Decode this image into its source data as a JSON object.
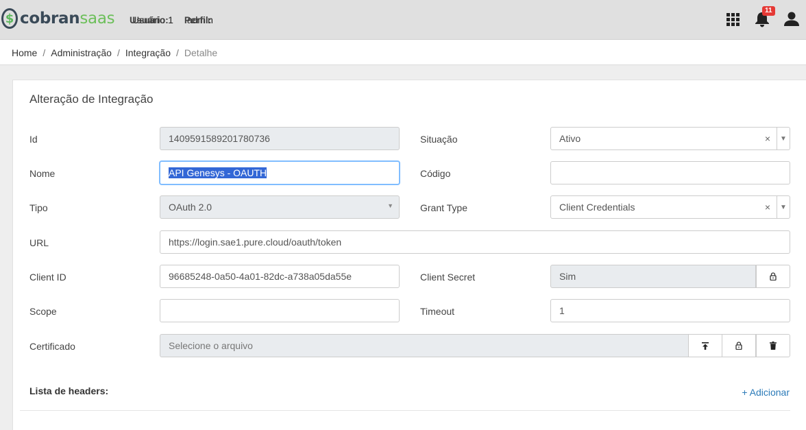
{
  "app": {
    "logo_mark": "$",
    "logo_part1": "cobran",
    "logo_part2": "saas",
    "user_label": "Usuário:",
    "user_value": "Usuário 1",
    "profile_label": "Perfil:",
    "profile_value": "admin",
    "notification_count": "11"
  },
  "breadcrumb": {
    "items": [
      "Home",
      "Administração",
      "Integração"
    ],
    "active": "Detalhe",
    "separator": "/"
  },
  "form": {
    "title": "Alteração de Integração",
    "id": {
      "label": "Id",
      "value": "1409591589201780736"
    },
    "situacao": {
      "label": "Situação",
      "value": "Ativo",
      "clear": "×"
    },
    "nome": {
      "label": "Nome",
      "value": "API Genesys  - OAUTH"
    },
    "codigo": {
      "label": "Código",
      "value": ""
    },
    "tipo": {
      "label": "Tipo",
      "value": "OAuth 2.0"
    },
    "grant_type": {
      "label": "Grant Type",
      "value": "Client Credentials",
      "clear": "×"
    },
    "url": {
      "label": "URL",
      "value": "https://login.sae1.pure.cloud/oauth/token"
    },
    "client_id": {
      "label": "Client ID",
      "value": "96685248-0a50-4a01-82dc-a738a05da55e"
    },
    "client_secret": {
      "label": "Client Secret",
      "value": "Sim"
    },
    "scope": {
      "label": "Scope",
      "value": ""
    },
    "timeout": {
      "label": "Timeout",
      "value": "1"
    },
    "certificado": {
      "label": "Certificado",
      "placeholder": "Selecione o arquivo"
    },
    "headers_label": "Lista de headers:",
    "add_label": "+ Adicionar"
  },
  "colors": {
    "accent": "#2a7ab8",
    "brand_green": "#6cbf5a",
    "brand_dark": "#3a4a58",
    "badge": "#e53935"
  },
  "icons": [
    "apps-grid-icon",
    "bell-icon",
    "user-icon",
    "lock-icon",
    "upload-icon",
    "trash-icon"
  ]
}
